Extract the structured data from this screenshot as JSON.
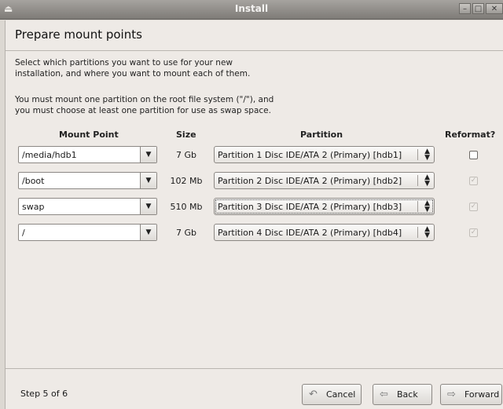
{
  "window": {
    "title": "Install",
    "controls": [
      "minimize",
      "maximize",
      "close"
    ]
  },
  "page": {
    "title": "Prepare mount points",
    "intro_line1": "Select which partitions you want to use for your new",
    "intro_line2": "installation, and where you want to mount each of them.",
    "warn_line1": "You must mount one partition on the root file system (\"/\"), and",
    "warn_line2": "you must choose at least one partition for use as swap space."
  },
  "columns": {
    "mount_point": "Mount Point",
    "size": "Size",
    "partition": "Partition",
    "reformat": "Reformat?"
  },
  "rows": [
    {
      "mount": "/media/hdb1",
      "size": "7 Gb",
      "partition": "Partition 1 Disc IDE/ATA 2 (Primary) [hdb1]",
      "reformat": false,
      "reformat_enabled": true
    },
    {
      "mount": "/boot",
      "size": "102 Mb",
      "partition": "Partition 2 Disc IDE/ATA 2 (Primary) [hdb2]",
      "reformat": true,
      "reformat_enabled": false
    },
    {
      "mount": "swap",
      "size": "510 Mb",
      "partition": "Partition 3 Disc IDE/ATA 2 (Primary) [hdb3]",
      "reformat": true,
      "reformat_enabled": false
    },
    {
      "mount": "/",
      "size": "7 Gb",
      "partition": "Partition 4 Disc IDE/ATA 2 (Primary) [hdb4]",
      "reformat": true,
      "reformat_enabled": false
    }
  ],
  "footer": {
    "step": "Step 5 of 6",
    "cancel": "Cancel",
    "back": "Back",
    "forward": "Forward"
  }
}
